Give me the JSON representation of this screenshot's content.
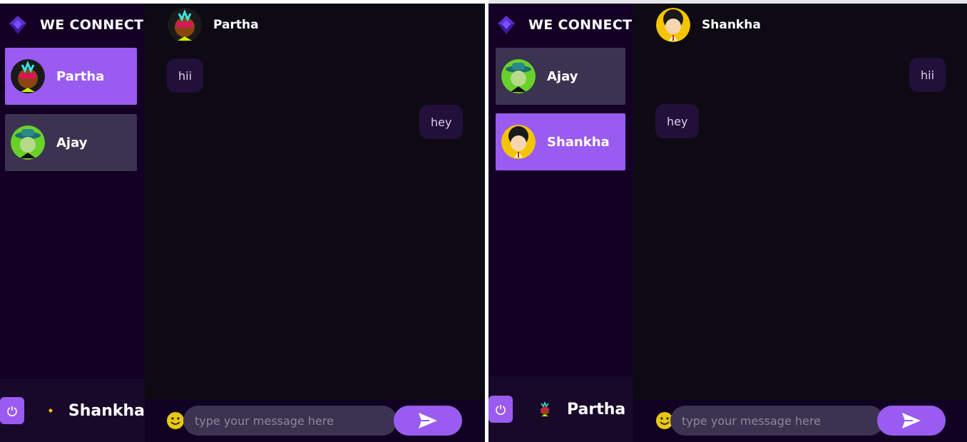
{
  "left_window": {
    "brand": "WE CONNECT",
    "contacts": [
      {
        "name": "Partha",
        "state": "active"
      },
      {
        "name": "Ajay",
        "state": "inactive"
      }
    ],
    "current_user": "Shankha",
    "chat_header": "Partha",
    "messages": [
      {
        "text": "hii",
        "side": "received"
      },
      {
        "text": "hey",
        "side": "sent"
      }
    ],
    "input_placeholder": "type your message here"
  },
  "right_window": {
    "brand": "WE CONNECT",
    "contacts": [
      {
        "name": "Ajay",
        "state": "inactive"
      },
      {
        "name": "Shankha",
        "state": "active"
      }
    ],
    "current_user": "Partha",
    "chat_header": "Shankha",
    "messages": [
      {
        "text": "hii",
        "side": "sent"
      },
      {
        "text": "hey",
        "side": "received"
      }
    ],
    "input_placeholder": "type your message here"
  },
  "colors": {
    "accent": "#9a5cf0",
    "sidebar_bg": "#130024",
    "chat_bg": "#0d0a14",
    "bubble_bg": "#22103a",
    "inactive_contact_bg": "#3c3350"
  },
  "icons": [
    "diamond-logo-icon",
    "power-icon",
    "emoji-icon",
    "send-icon"
  ]
}
